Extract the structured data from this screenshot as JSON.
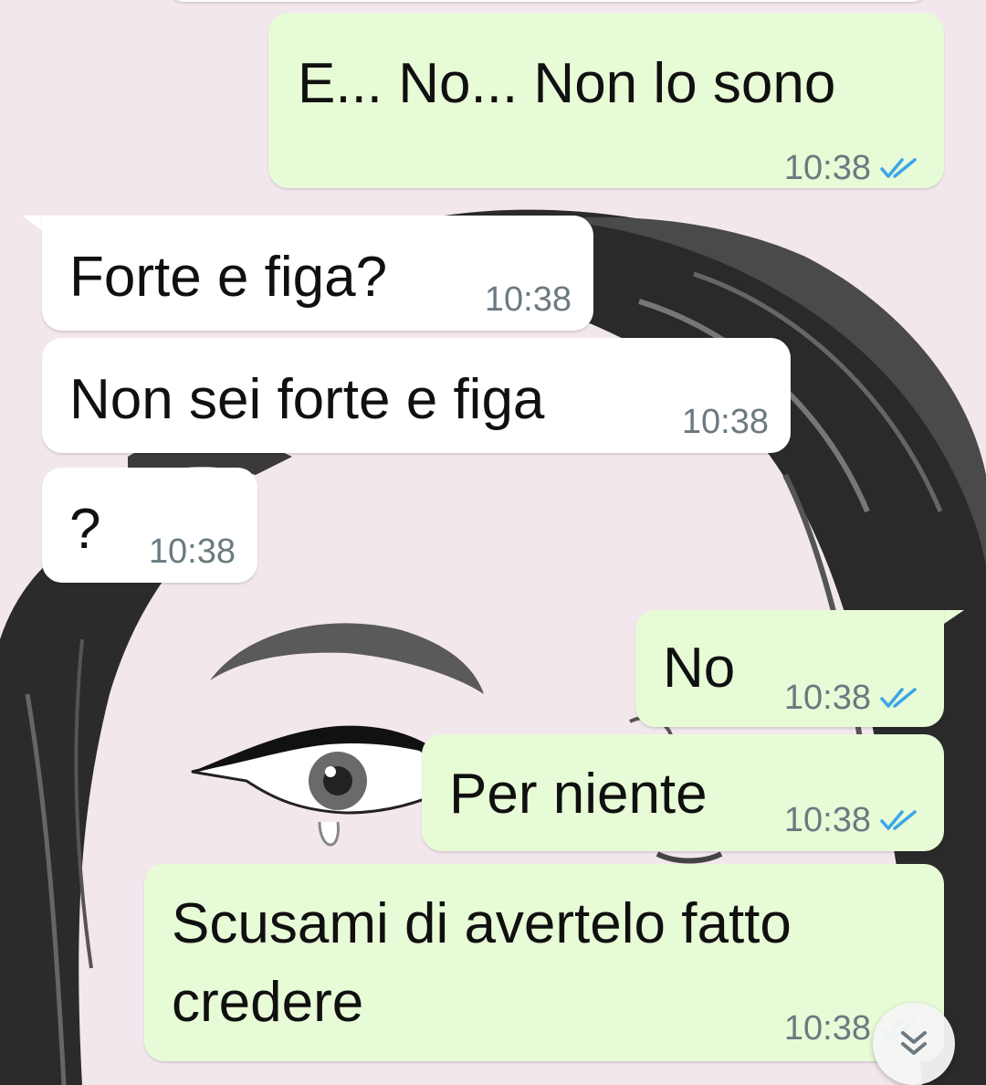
{
  "colors": {
    "outgoing_bubble": "#e8fbd7",
    "incoming_bubble": "#ffffff",
    "read_ticks": "#3aa6e8",
    "wallpaper": "#f3e7ee"
  },
  "messages": [
    {
      "direction": "outgoing",
      "text": "E... No... Non lo sono",
      "time": "10:38",
      "status": "read"
    },
    {
      "direction": "incoming",
      "text": "Forte e figa?",
      "time": "10:38"
    },
    {
      "direction": "incoming",
      "text": "Non sei forte e figa",
      "time": "10:38"
    },
    {
      "direction": "incoming",
      "text": "?",
      "time": "10:38"
    },
    {
      "direction": "outgoing",
      "text": "No",
      "time": "10:38",
      "status": "read"
    },
    {
      "direction": "outgoing",
      "text": "Per niente",
      "time": "10:38",
      "status": "read"
    },
    {
      "direction": "outgoing",
      "text_line1": "Scusami di avertelo fatto",
      "text_line2": "credere",
      "time": "10:38",
      "status": "read"
    }
  ],
  "scroll_button": {
    "icon": "double-chevron-down-icon"
  }
}
